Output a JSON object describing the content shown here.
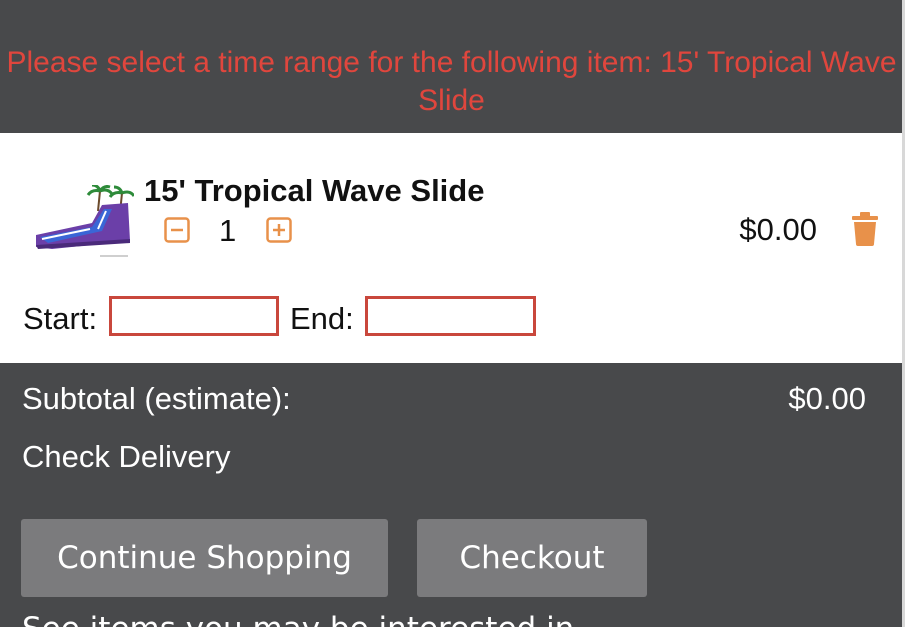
{
  "cart": {
    "warning_message": "Please select a time range for the following item: 15' Tropical Wave Slide",
    "item": {
      "name": "15' Tropical Wave Slide",
      "quantity": "1",
      "price": "$0.00",
      "image_icon": "inflatable-water-slide-thumbnail",
      "minus_icon": "minus-square-icon",
      "plus_icon": "plus-square-icon",
      "delete_icon": "trash-icon"
    },
    "dates": {
      "start_label": "Start:",
      "start_value": "",
      "end_label": "End:",
      "end_value": ""
    },
    "subtotal_label": "Subtotal (estimate):",
    "subtotal_value": "$0.00",
    "check_delivery": "Check Delivery",
    "continue_label": "Continue Shopping",
    "checkout_label": "Checkout",
    "cutoff_text": "See items you may be interested in"
  },
  "colors": {
    "background": "#48494b",
    "warning": "#e0463d",
    "accent_orange": "#e8914a",
    "input_border_error": "#c9473c",
    "button": "#7b7b7d"
  }
}
